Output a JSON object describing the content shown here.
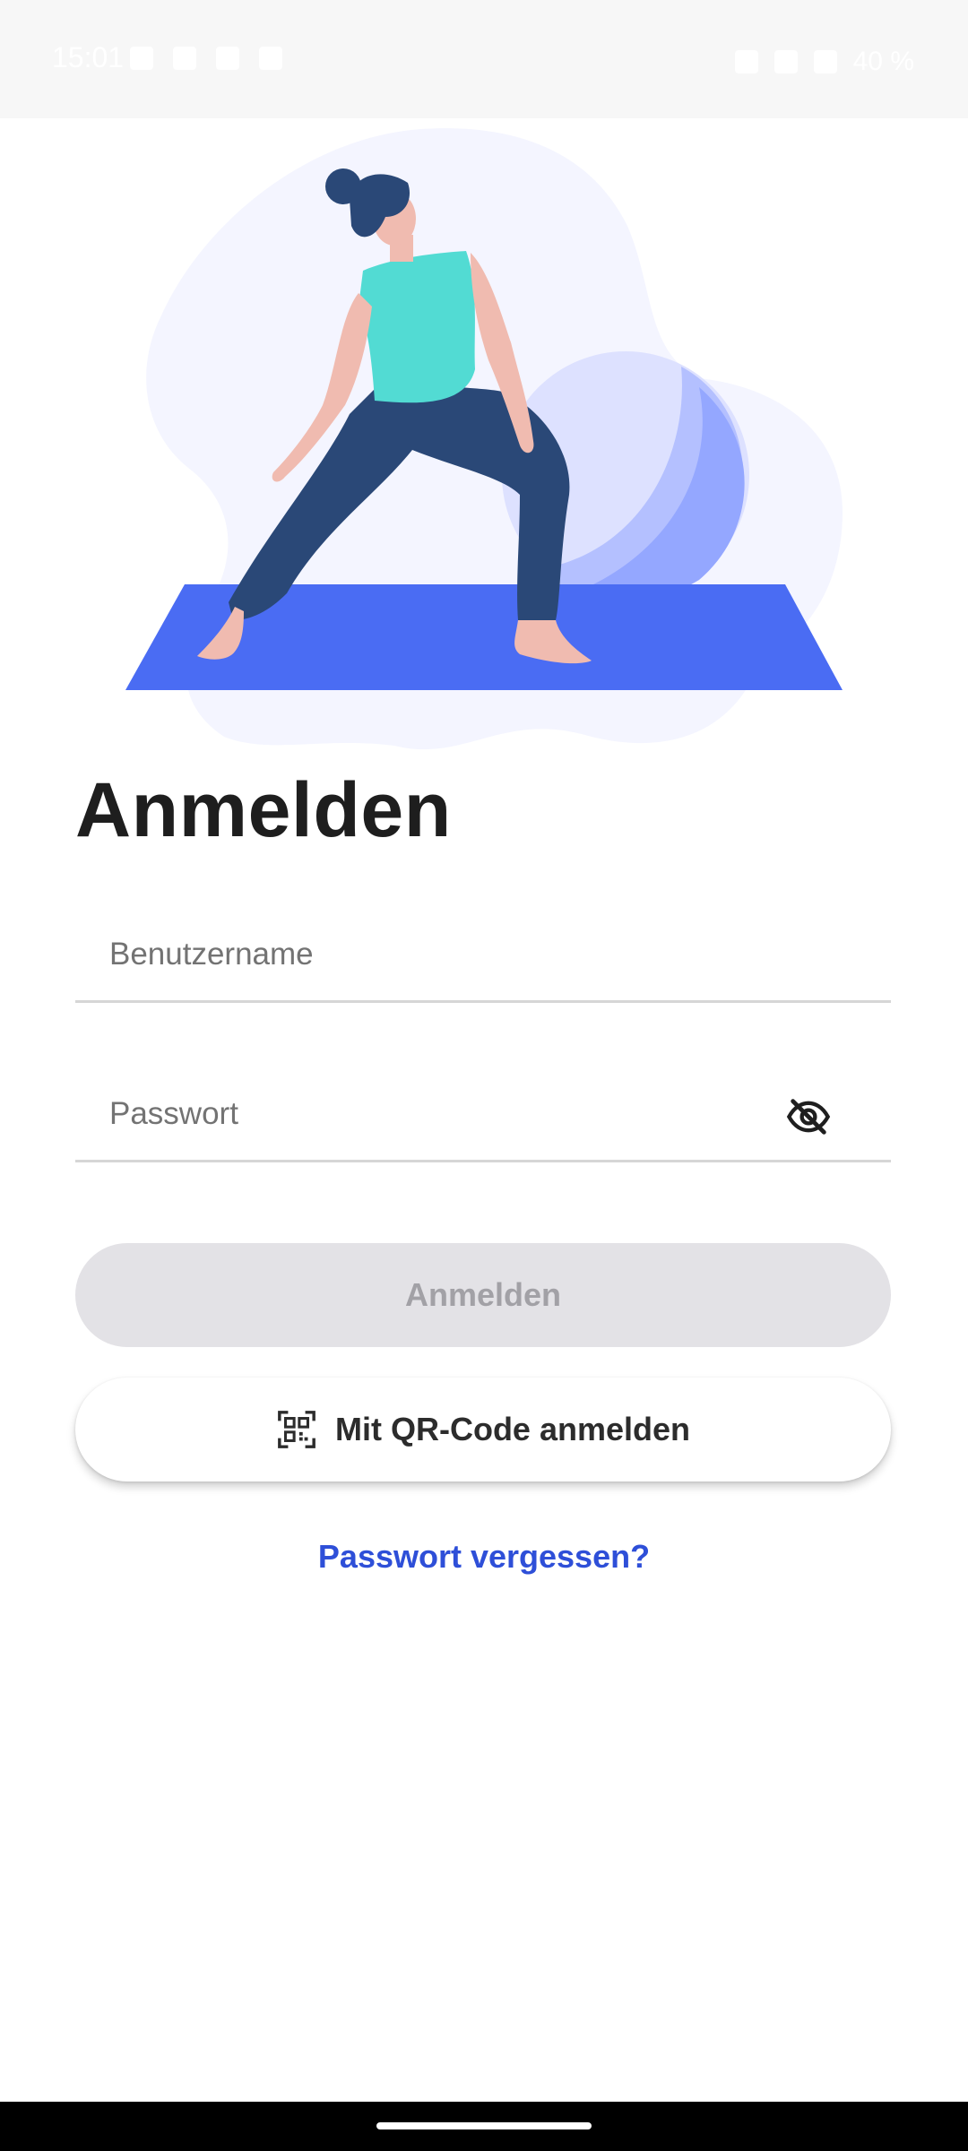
{
  "status_bar": {
    "time": "15:01",
    "battery": "40 %"
  },
  "login": {
    "title": "Anmelden",
    "username_placeholder": "Benutzername",
    "password_placeholder": "Passwort",
    "login_button": "Anmelden",
    "qr_button": "Mit QR-Code anmelden",
    "forgot_link": "Passwort vergessen?"
  },
  "colors": {
    "accent": "#4a6cf3",
    "link": "#2e4fd8",
    "disabled_button": "#e3e2e6",
    "title_text": "#1e1e1e"
  },
  "icons": {
    "password_toggle": "eye-off-icon",
    "qr": "qr-code-icon"
  }
}
